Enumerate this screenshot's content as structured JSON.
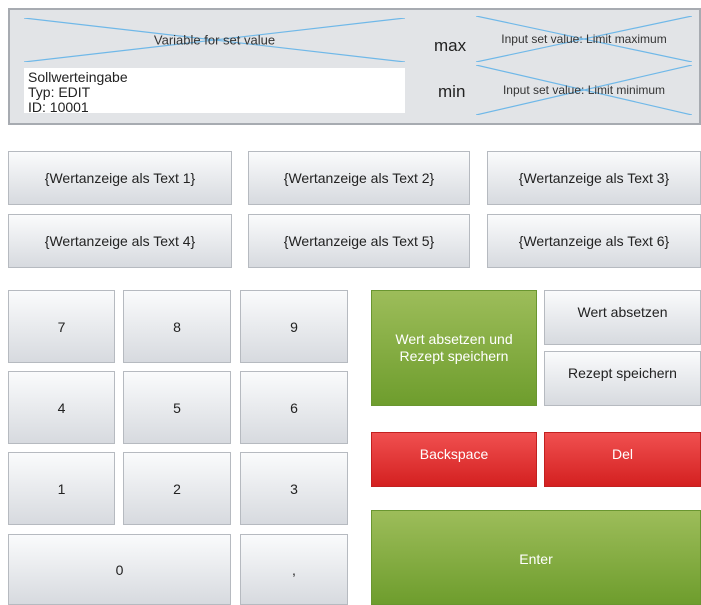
{
  "header": {
    "variable_label": "Variable for set value",
    "max_label": "max",
    "min_label": "min",
    "limit_max_label": "Input set value: Limit maximum",
    "limit_min_label": "Input set value: Limit minimum",
    "edit_lines": [
      "Sollwerteingabe",
      "Typ: EDIT",
      "ID: 10001"
    ]
  },
  "value_buttons": [
    "{Wertanzeige als Text 1}",
    "{Wertanzeige als Text 2}",
    "{Wertanzeige als Text 3}",
    "{Wertanzeige als Text 4}",
    "{Wertanzeige als Text 5}",
    "{Wertanzeige als Text 6}"
  ],
  "keypad": {
    "k7": "7",
    "k8": "8",
    "k9": "9",
    "k4": "4",
    "k5": "5",
    "k6": "6",
    "k1": "1",
    "k2": "2",
    "k3": "3",
    "k0": "0",
    "comma": ","
  },
  "actions": {
    "submit_and_save_line1": "Wert absetzen und",
    "submit_and_save_line2": "Rezept speichern",
    "submit": "Wert absetzen",
    "save_recipe": "Rezept speichern",
    "backspace": "Backspace",
    "del": "Del",
    "enter": "Enter"
  },
  "colors": {
    "accent_green": "#7aa83a",
    "accent_red": "#e03030",
    "placeholder_cross": "#6fb8e8"
  }
}
